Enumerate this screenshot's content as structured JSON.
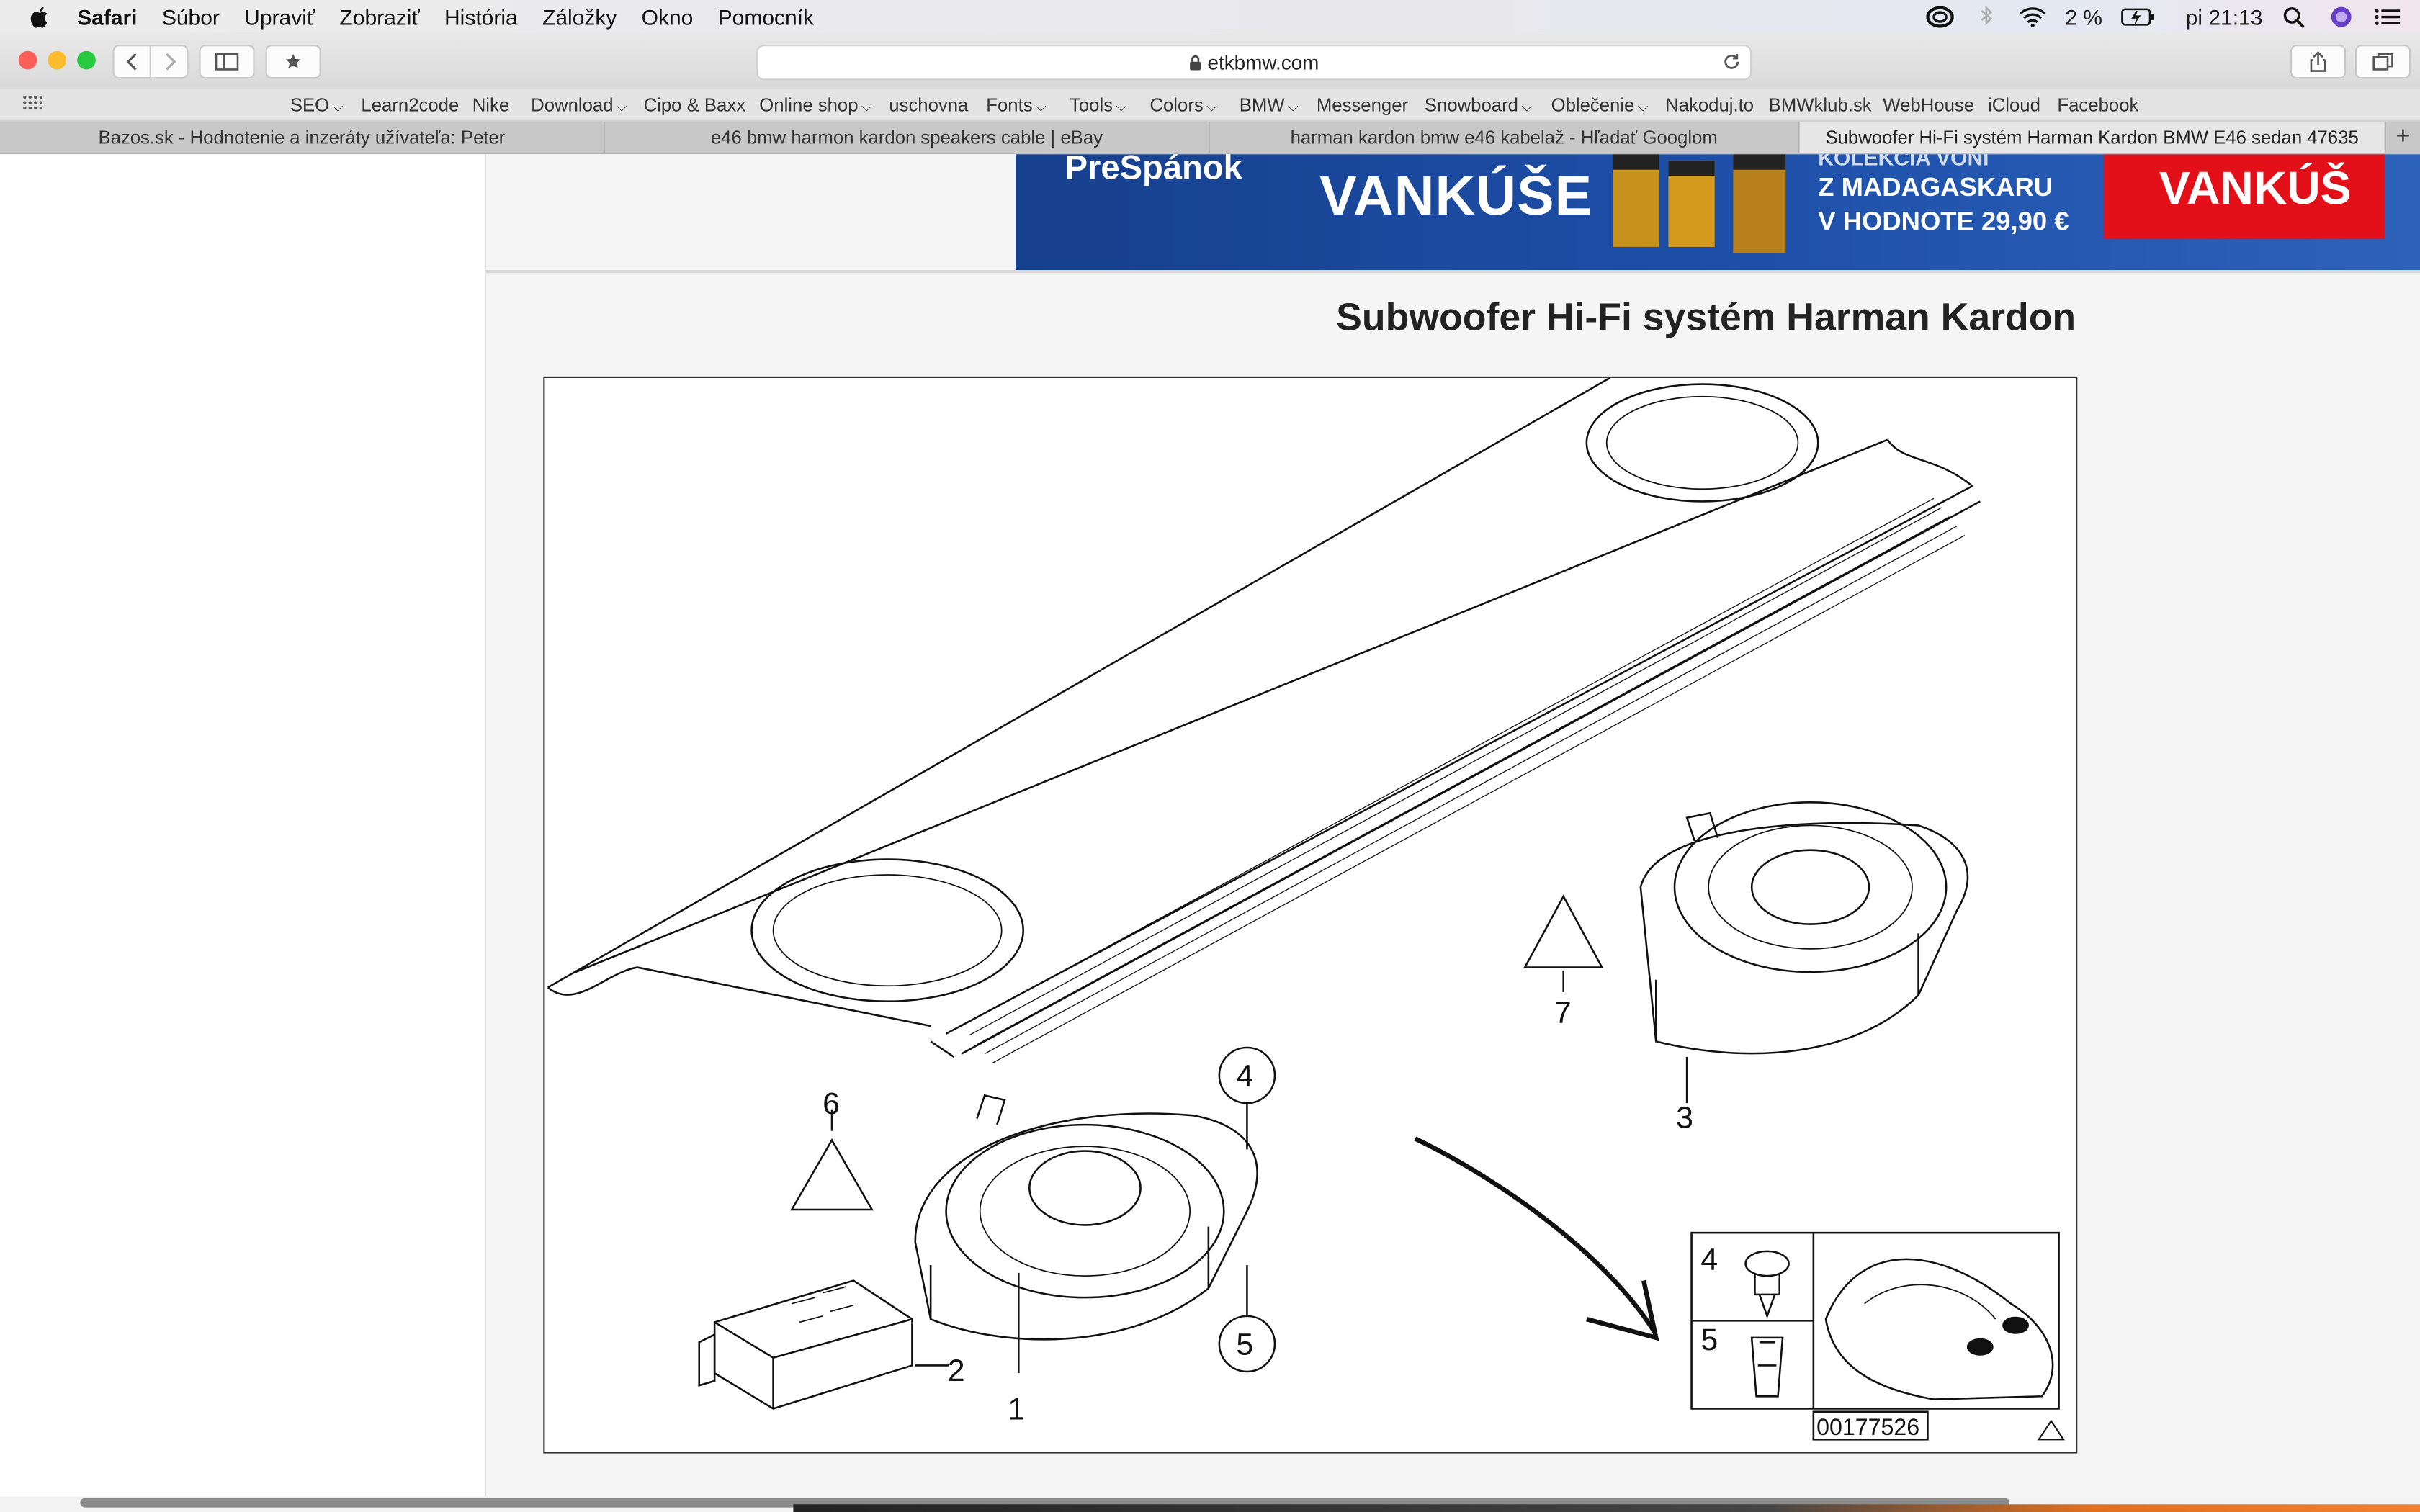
{
  "menubar": {
    "app": "Safari",
    "items": [
      "Súbor",
      "Upraviť",
      "Zobraziť",
      "História",
      "Záložky",
      "Okno",
      "Pomocník"
    ],
    "battery": "2 %",
    "clock": "pi 21:13"
  },
  "toolbar": {
    "url": "etkbmw.com"
  },
  "bookmarks": [
    {
      "label": "SEO",
      "menu": true
    },
    {
      "label": "Learn2code",
      "menu": false
    },
    {
      "label": "Nike",
      "menu": false
    },
    {
      "label": "Download",
      "menu": true
    },
    {
      "label": "Cipo & Baxx",
      "menu": false
    },
    {
      "label": "Online shop",
      "menu": true
    },
    {
      "label": "uschovna",
      "menu": false
    },
    {
      "label": "Fonts",
      "menu": true
    },
    {
      "label": "Tools",
      "menu": true
    },
    {
      "label": "Colors",
      "menu": true
    },
    {
      "label": "BMW",
      "menu": true
    },
    {
      "label": "Messenger",
      "menu": false
    },
    {
      "label": "Snowboard",
      "menu": true
    },
    {
      "label": "Oblečenie",
      "menu": true
    },
    {
      "label": "Nakoduj.to",
      "menu": false
    },
    {
      "label": "BMWklub.sk",
      "menu": false
    },
    {
      "label": "WebHouse",
      "menu": false
    },
    {
      "label": "iCloud",
      "menu": false
    },
    {
      "label": "Facebook",
      "menu": false
    }
  ],
  "tabs": [
    {
      "label": "Bazos.sk - Hodnotenie a inzeráty užívateľa: Peter",
      "active": false
    },
    {
      "label": "e46 bmw harmon kardon speakers cable | eBay",
      "active": false
    },
    {
      "label": "harman kardon bmw e46 kabelaž - Hľadať Googlom",
      "active": false
    },
    {
      "label": "Subwoofer Hi-Fi systém Harman Kardon BMW E46 sedan 47635",
      "active": true
    }
  ],
  "new_tab": "+",
  "banner": {
    "brand": "PreSpánok",
    "headline": "VANKÚŠE",
    "line1": "KOLEKCIA VÔNÍ",
    "line2": "Z MADAGASKARU",
    "line3": "V HODNOTE 29,90 €",
    "cta": "VANKÚŠ"
  },
  "page": {
    "title": "Subwoofer Hi-Fi systém Harman Kardon"
  },
  "diagram": {
    "part_labels": [
      "1",
      "2",
      "3",
      "4",
      "5",
      "6",
      "7"
    ],
    "inset_labels": [
      "4",
      "5"
    ],
    "image_number": "00177526"
  },
  "colors": {
    "banner_blue": "#1d4fa8",
    "banner_red": "#e3101a",
    "traffic_close": "#fc5f57",
    "traffic_min": "#fdbc2e",
    "traffic_max": "#28c840"
  }
}
